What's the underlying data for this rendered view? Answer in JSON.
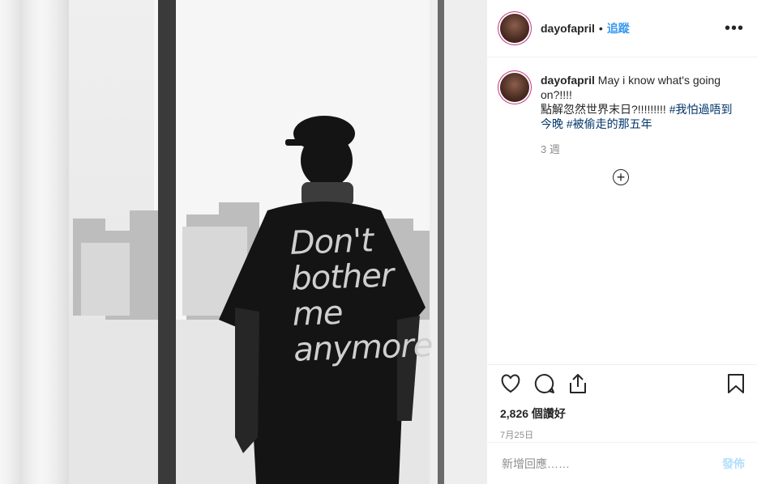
{
  "photo": {
    "shirt_text": [
      "Don't",
      "bother",
      "me",
      "anymore"
    ]
  },
  "header": {
    "username": "dayofapril",
    "separator": "•",
    "follow_label": "追蹤",
    "more_label": "•••"
  },
  "caption": {
    "username": "dayofapril",
    "text_line1": "May i know what's going on?!!!!",
    "text_line2": "點解忽然世界末日?!!!!!!!!!",
    "hashtag1": "#我怕過唔到今晚",
    "hashtag2": "#被偷走的那五年",
    "time": "3 週"
  },
  "load_more_label": "+",
  "actions": {
    "like_icon": "heart-icon",
    "comment_icon": "comment-icon",
    "share_icon": "share-icon",
    "save_icon": "bookmark-icon",
    "likes_text": "2,826 個讚好",
    "date_text": "7月25日"
  },
  "add_comment": {
    "placeholder": "新增回應……",
    "post_label": "發佈"
  },
  "colors": {
    "link": "#3897f0",
    "hashtag": "#003569",
    "muted": "#8e8e8e",
    "post_disabled": "#b2dffc"
  }
}
